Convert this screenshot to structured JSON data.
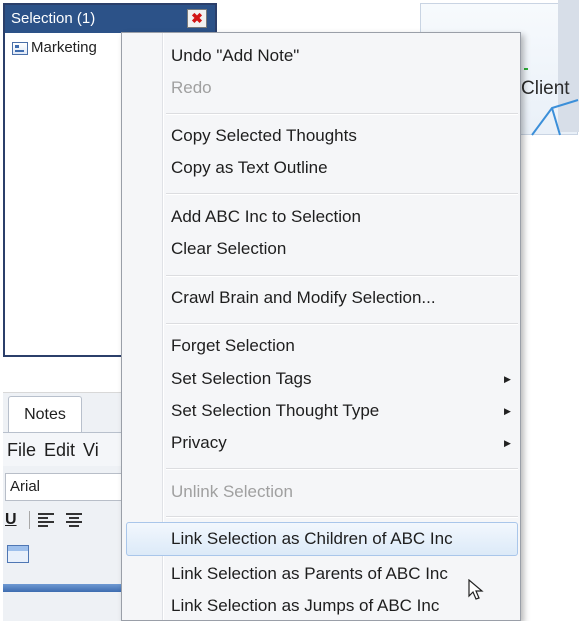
{
  "selection_panel": {
    "title": "Selection (1)",
    "close_glyph": "✖",
    "items": [
      {
        "label": "Marketing",
        "icon": "thought-icon"
      }
    ]
  },
  "map": {
    "node_label": "Client"
  },
  "notes_panel": {
    "tab_label": "Notes",
    "menu": [
      "File",
      "Edit",
      "Vi"
    ],
    "font": "Arial",
    "underline_glyph": "U",
    "icons": [
      "underline-icon",
      "align-left-icon",
      "align-center-icon",
      "calendar-icon"
    ]
  },
  "context_menu": {
    "undo": "Undo \"Add Note\"",
    "redo": "Redo",
    "copy_selected": "Copy Selected Thoughts",
    "copy_outline": "Copy as Text Outline",
    "add_to_selection": "Add ABC Inc to Selection",
    "clear_selection": "Clear Selection",
    "crawl_brain": "Crawl Brain and Modify Selection...",
    "forget_selection": "Forget Selection",
    "set_tags": "Set Selection Tags",
    "set_thought_type": "Set Selection Thought Type",
    "privacy": "Privacy",
    "unlink_selection": "Unlink Selection",
    "link_children": "Link Selection as Children of ABC Inc",
    "link_parents": "Link Selection as Parents of ABC Inc",
    "link_jumps": "Link Selection as Jumps of ABC Inc",
    "submenu_arrow": "▶"
  },
  "colors": {
    "titlebar": "#2c5288",
    "menu_bg": "#f5f6f8",
    "highlight_border": "#a9c6ea",
    "disabled_text": "#a0a0a0"
  }
}
